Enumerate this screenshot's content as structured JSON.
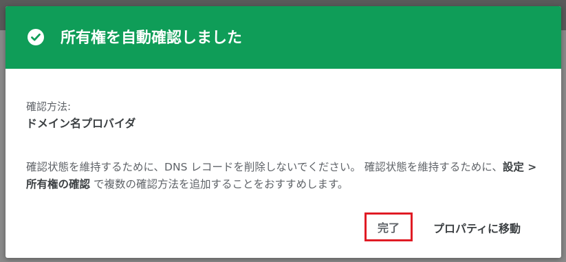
{
  "dialog": {
    "title": "所有権を自動確認しました",
    "header_color": "#0f9d58",
    "header_icon": "check-circle-icon",
    "method_label": "確認方法:",
    "method_value": "ドメイン名プロバイダ",
    "message": {
      "part1": "確認状態を維持するために、DNS レコードを削除しないでください。 確認状態を維持するために、",
      "bold": "設定 > 所有権の確認",
      "part2": " で複数の確認方法を追加することをおすすめします。"
    },
    "buttons": {
      "done": "完了",
      "go_to_property": "プロパティに移動"
    },
    "highlight_color": "#e01b24"
  }
}
